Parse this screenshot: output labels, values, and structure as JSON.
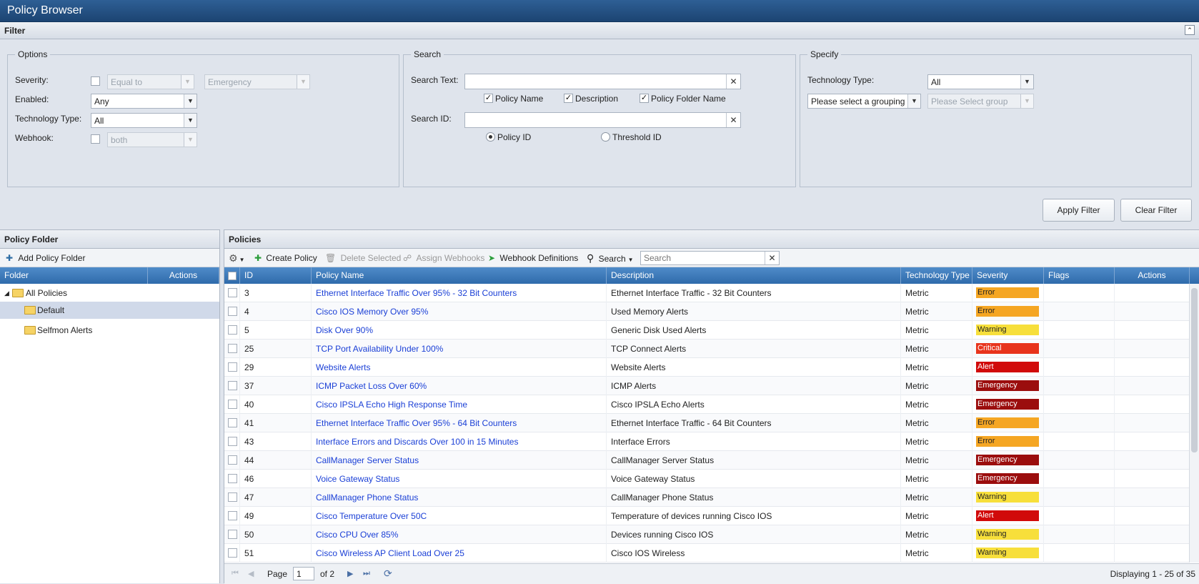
{
  "window": {
    "title": "Policy Browser"
  },
  "filter": {
    "title": "Filter",
    "options": {
      "legend": "Options",
      "severity_label": "Severity:",
      "severity_op": "Equal to",
      "severity_value": "Emergency",
      "enabled_label": "Enabled:",
      "enabled_value": "Any",
      "tech_label": "Technology Type:",
      "tech_value": "All",
      "webhook_label": "Webhook:",
      "webhook_value": "both"
    },
    "search": {
      "legend": "Search",
      "text_label": "Search Text:",
      "cb_policy_name": "Policy Name",
      "cb_description": "Description",
      "cb_folder_name": "Policy Folder Name",
      "id_label": "Search ID:",
      "radio_policy_id": "Policy ID",
      "radio_threshold_id": "Threshold ID"
    },
    "specify": {
      "legend": "Specify",
      "tech_label": "Technology Type:",
      "tech_value": "All",
      "grouping_value": "Please select a grouping",
      "group_value": "Please Select group"
    },
    "apply_label": "Apply Filter",
    "clear_label": "Clear Filter"
  },
  "folders": {
    "title": "Policy Folder",
    "add_label": "Add Policy Folder",
    "col_folder": "Folder",
    "col_actions": "Actions",
    "items": [
      {
        "label": "All Policies"
      },
      {
        "label": "Default"
      },
      {
        "label": "Selfmon Alerts"
      }
    ]
  },
  "policies": {
    "title": "Policies",
    "toolbar": {
      "create": "Create Policy",
      "delete": "Delete Selected",
      "assign": "Assign Webhooks",
      "webhook_defs": "Webhook Definitions",
      "search": "Search",
      "search_placeholder": "Search"
    },
    "columns": {
      "id": "ID",
      "name": "Policy Name",
      "description": "Description",
      "tech": "Technology Type",
      "severity": "Severity",
      "flags": "Flags",
      "actions": "Actions"
    },
    "severity_colors": {
      "Error": "#f5a623",
      "Warning": "#f7df3b",
      "Critical": "#e8341c",
      "Alert": "#d10a0a",
      "Emergency": "#9b0d0d"
    },
    "rows": [
      {
        "id": "3",
        "name": "Ethernet Interface Traffic Over 95% - 32 Bit Counters",
        "description": "Ethernet Interface Traffic - 32 Bit Counters",
        "tech": "Metric",
        "severity": "Error"
      },
      {
        "id": "4",
        "name": "Cisco IOS Memory Over 95%",
        "description": "Used Memory Alerts",
        "tech": "Metric",
        "severity": "Error"
      },
      {
        "id": "5",
        "name": "Disk Over 90%",
        "description": "Generic Disk Used Alerts",
        "tech": "Metric",
        "severity": "Warning"
      },
      {
        "id": "25",
        "name": "TCP Port Availability Under 100%",
        "description": "TCP Connect Alerts",
        "tech": "Metric",
        "severity": "Critical"
      },
      {
        "id": "29",
        "name": "Website Alerts",
        "description": "Website Alerts",
        "tech": "Metric",
        "severity": "Alert"
      },
      {
        "id": "37",
        "name": "ICMP Packet Loss Over 60%",
        "description": "ICMP Alerts",
        "tech": "Metric",
        "severity": "Emergency"
      },
      {
        "id": "40",
        "name": "Cisco IPSLA Echo High Response Time",
        "description": "Cisco IPSLA Echo Alerts",
        "tech": "Metric",
        "severity": "Emergency"
      },
      {
        "id": "41",
        "name": "Ethernet Interface Traffic Over 95% - 64 Bit Counters",
        "description": "Ethernet Interface Traffic - 64 Bit Counters",
        "tech": "Metric",
        "severity": "Error"
      },
      {
        "id": "43",
        "name": "Interface Errors and Discards Over 100 in 15 Minutes",
        "description": "Interface Errors",
        "tech": "Metric",
        "severity": "Error"
      },
      {
        "id": "44",
        "name": "CallManager Server Status",
        "description": "CallManager Server Status",
        "tech": "Metric",
        "severity": "Emergency"
      },
      {
        "id": "46",
        "name": "Voice Gateway Status",
        "description": "Voice Gateway Status",
        "tech": "Metric",
        "severity": "Emergency"
      },
      {
        "id": "47",
        "name": "CallManager Phone Status",
        "description": "CallManager Phone Status",
        "tech": "Metric",
        "severity": "Warning"
      },
      {
        "id": "49",
        "name": "Cisco Temperature Over 50C",
        "description": "Temperature of devices running Cisco IOS",
        "tech": "Metric",
        "severity": "Alert"
      },
      {
        "id": "50",
        "name": "Cisco CPU Over 85%",
        "description": "Devices running Cisco IOS",
        "tech": "Metric",
        "severity": "Warning"
      },
      {
        "id": "51",
        "name": "Cisco Wireless AP Client Load Over 25",
        "description": "Cisco IOS Wireless",
        "tech": "Metric",
        "severity": "Warning"
      }
    ],
    "pager": {
      "page_label": "Page",
      "page_value": "1",
      "of_label": "of 2",
      "display": "Displaying 1 - 25 of 35"
    }
  }
}
